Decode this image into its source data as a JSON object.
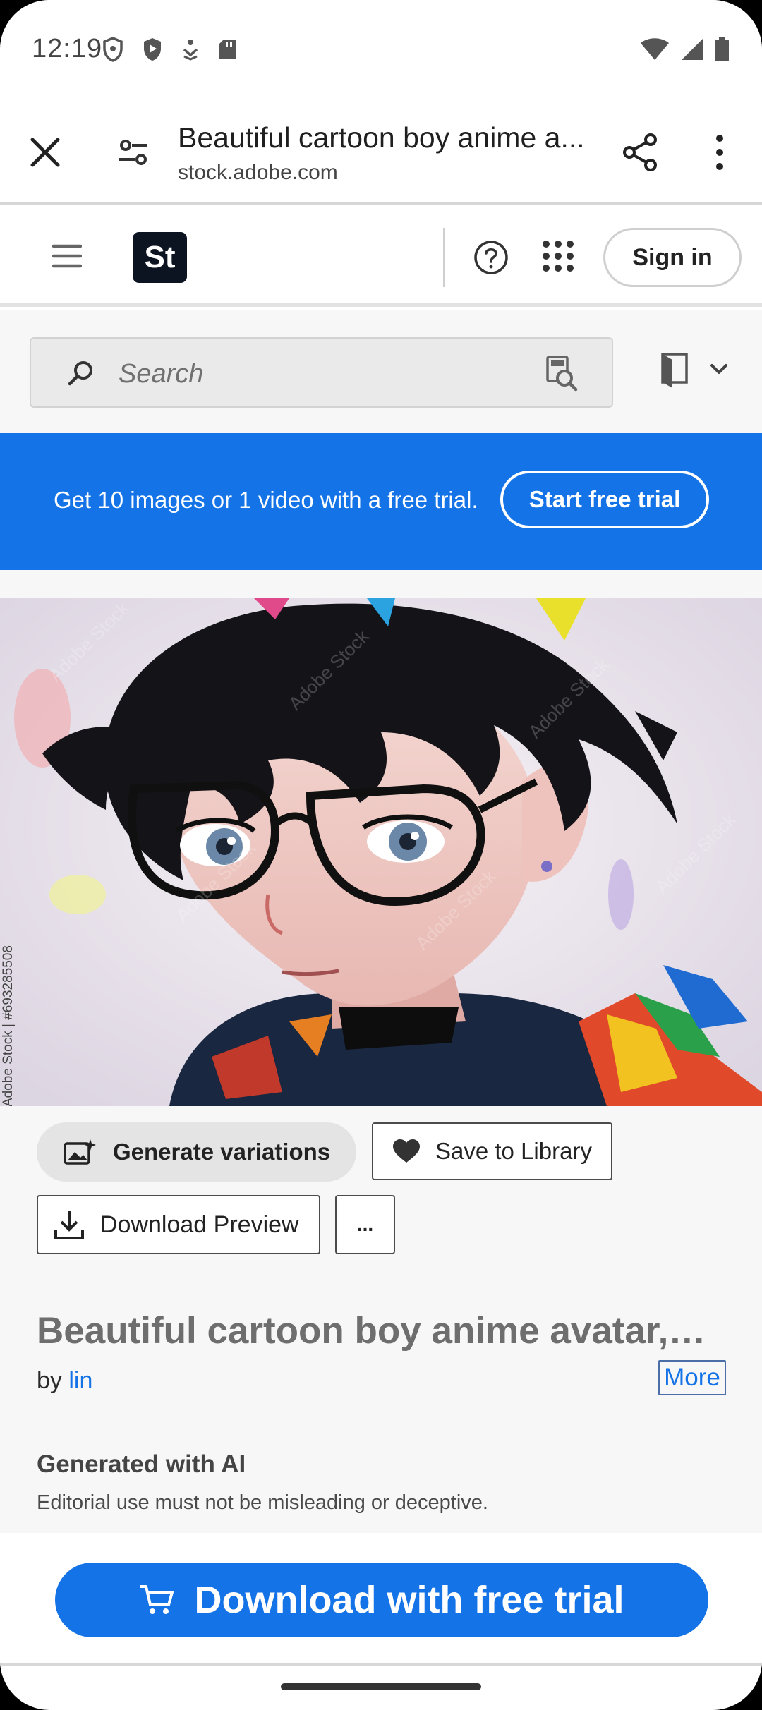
{
  "status_bar": {
    "time": "12:19",
    "icons": [
      "shield-outline-icon",
      "shield-filled-icon",
      "person-download-icon",
      "sd-card-icon"
    ],
    "right_icons": [
      "wifi-icon",
      "signal-icon",
      "battery-icon"
    ]
  },
  "browser": {
    "title": "Beautiful cartoon boy anime a...",
    "url": "stock.adobe.com"
  },
  "header": {
    "logo": "St",
    "sign_in": "Sign in"
  },
  "search": {
    "placeholder": "Search"
  },
  "banner": {
    "text": "Get 10 images or 1 video with a free trial.",
    "cta": "Start free trial"
  },
  "asset": {
    "watermark_id": "Adobe Stock | #693285508",
    "watermark_text": "Adobe Stock",
    "actions": {
      "generate_variations": "Generate variations",
      "save_to_library": "Save to Library",
      "download_preview": "Download Preview",
      "more_dots": "..."
    },
    "title": "Beautiful cartoon boy anime avatar, y...",
    "by_prefix": "by",
    "author": "lin",
    "more_label": "More",
    "ai_heading": "Generated with AI",
    "ai_note": "Editorial use must not be misleading or deceptive."
  },
  "bottom": {
    "cta": "Download with free trial"
  },
  "colors": {
    "accent": "#1473e6",
    "logo_bg": "#0b1420"
  }
}
